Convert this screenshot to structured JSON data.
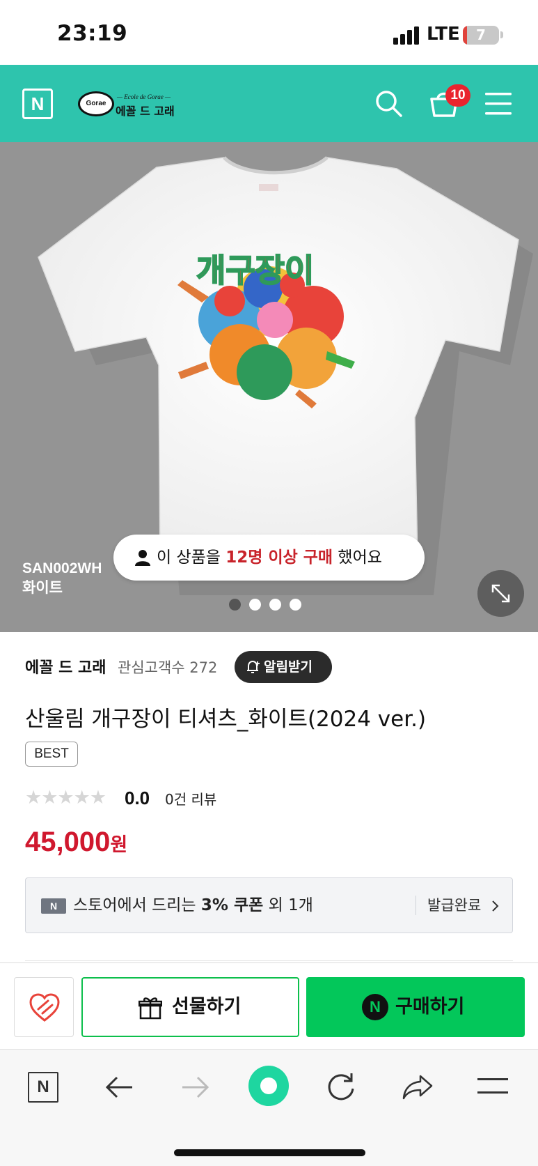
{
  "status_bar": {
    "time": "23:19",
    "network": "LTE",
    "battery": "7"
  },
  "header": {
    "logo_letter": "N",
    "brand_sub": "— Ecole de Gorae —",
    "brand_main": "에꼴 드 고래",
    "brand_mark": "Gorae",
    "cart_count": "10",
    "accent_color": "#2ec4ad"
  },
  "hero": {
    "sku_code": "SAN002WH",
    "sku_color": "화이트",
    "buyers_prefix": "이 상품을 ",
    "buyers_highlight": "12명 이상 구매",
    "buyers_suffix": " 했어요",
    "artwork_text": "개구장이",
    "slides": {
      "count": 4,
      "active": 1
    }
  },
  "product": {
    "store_name": "에꼴 드 고래",
    "followers": "관심고객수 272",
    "alert_label": "알림받기",
    "title": "산울림 개구장이 티셔츠_화이트(2024 ver.)",
    "badge": "BEST",
    "stars": "★★★★★",
    "rating": 0.0,
    "score": "0.0",
    "reviews": "0건 리뷰",
    "price": "45,000",
    "currency": "원",
    "price_color": "#d0182e"
  },
  "coupon": {
    "badge": "N",
    "text_prefix": "스토어에서 드리는 ",
    "text_bold": "3% 쿠폰",
    "text_suffix": " 외 1개",
    "status": "발급완료"
  },
  "actions": {
    "gift_label": "선물하기",
    "buy_label": "구매하기",
    "buy_badge": "N",
    "buy_color": "#03c75a"
  },
  "toolbar": {
    "home_letter": "N"
  }
}
